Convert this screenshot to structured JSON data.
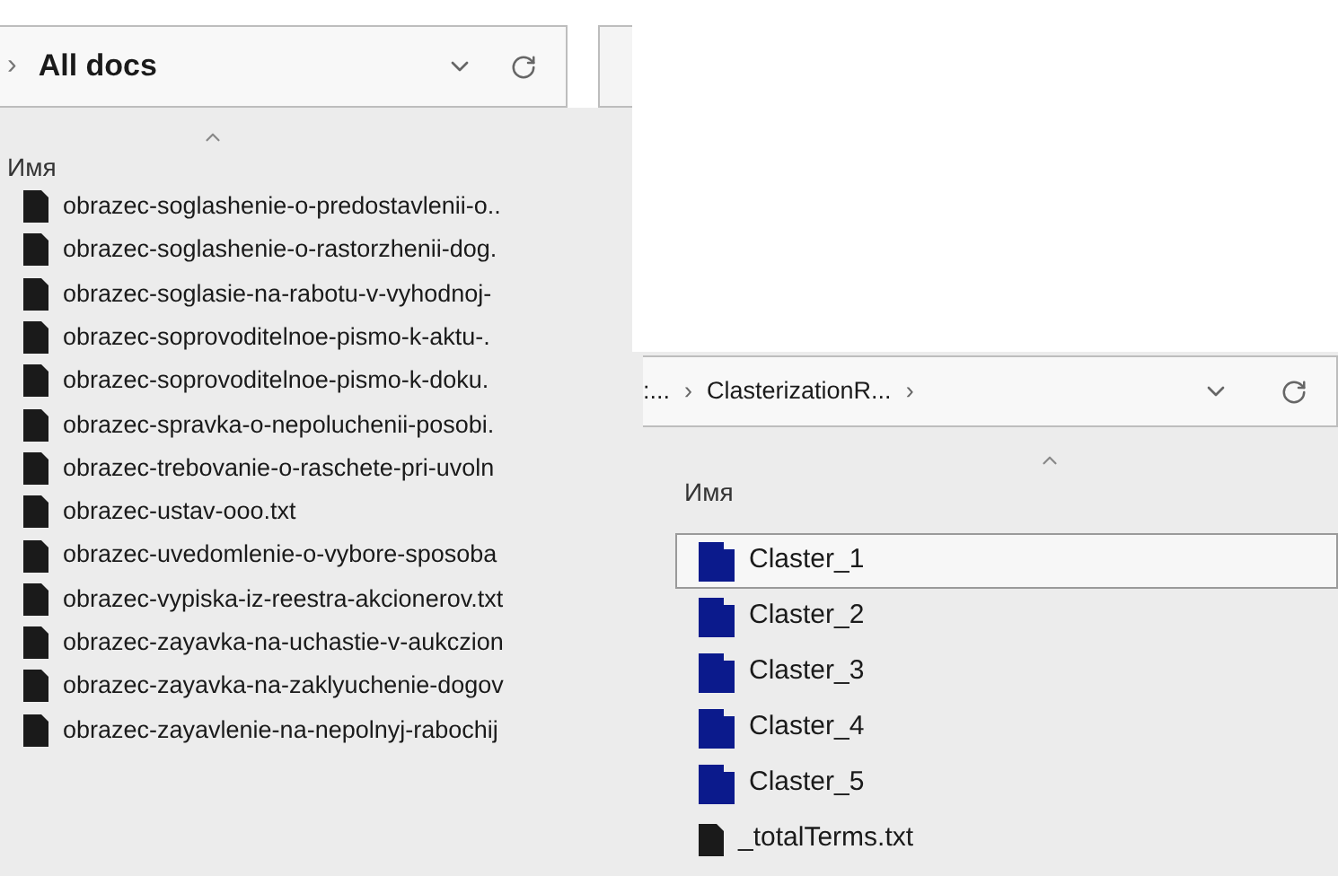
{
  "left_window": {
    "address_bar": {
      "separator": "›",
      "path": "All docs"
    },
    "column_header": "Имя",
    "items": [
      {
        "name": "obrazec-soglashenie-o-predostavlenii-o..",
        "kind": "file",
        "selected": false
      },
      {
        "name": "obrazec-soglashenie-o-rastorzhenii-dog.",
        "kind": "file",
        "selected": false
      },
      {
        "name": "obrazec-soglasie-na-rabotu-v-vyhodnoj-",
        "kind": "file",
        "selected": false
      },
      {
        "name": "obrazec-soprovoditelnoe-pismo-k-aktu-.",
        "kind": "file",
        "selected": false
      },
      {
        "name": "obrazec-soprovoditelnoe-pismo-k-doku.",
        "kind": "file",
        "selected": false
      },
      {
        "name": "obrazec-spravka-o-nepoluchenii-posobi.",
        "kind": "file",
        "selected": false
      },
      {
        "name": "obrazec-trebovanie-o-raschete-pri-uvoln",
        "kind": "file",
        "selected": false
      },
      {
        "name": "obrazec-ustav-ooo.txt",
        "kind": "file",
        "selected": false
      },
      {
        "name": "obrazec-uvedomlenie-o-vybore-sposoba",
        "kind": "file",
        "selected": false
      },
      {
        "name": "obrazec-vypiska-iz-reestra-akcionerov.txt",
        "kind": "file",
        "selected": false
      },
      {
        "name": "obrazec-zayavka-na-uchastie-v-aukczion",
        "kind": "file",
        "selected": false
      },
      {
        "name": "obrazec-zayavka-na-zaklyuchenie-dogov",
        "kind": "file",
        "selected": false
      },
      {
        "name": "obrazec-zayavlenie-na-nepolnyj-rabochij",
        "kind": "file",
        "selected": false
      }
    ]
  },
  "right_window": {
    "address_bar": {
      "crumbs": [
        ":...",
        "ClasterizationR..."
      ],
      "separator": "›"
    },
    "column_header": "Имя",
    "items": [
      {
        "name": "Claster_1",
        "kind": "folder",
        "selected": true
      },
      {
        "name": "Claster_2",
        "kind": "folder",
        "selected": false
      },
      {
        "name": "Claster_3",
        "kind": "folder",
        "selected": false
      },
      {
        "name": "Claster_4",
        "kind": "folder",
        "selected": false
      },
      {
        "name": "Claster_5",
        "kind": "folder",
        "selected": false
      },
      {
        "name": "_totalTerms.txt",
        "kind": "file",
        "selected": false
      }
    ]
  }
}
